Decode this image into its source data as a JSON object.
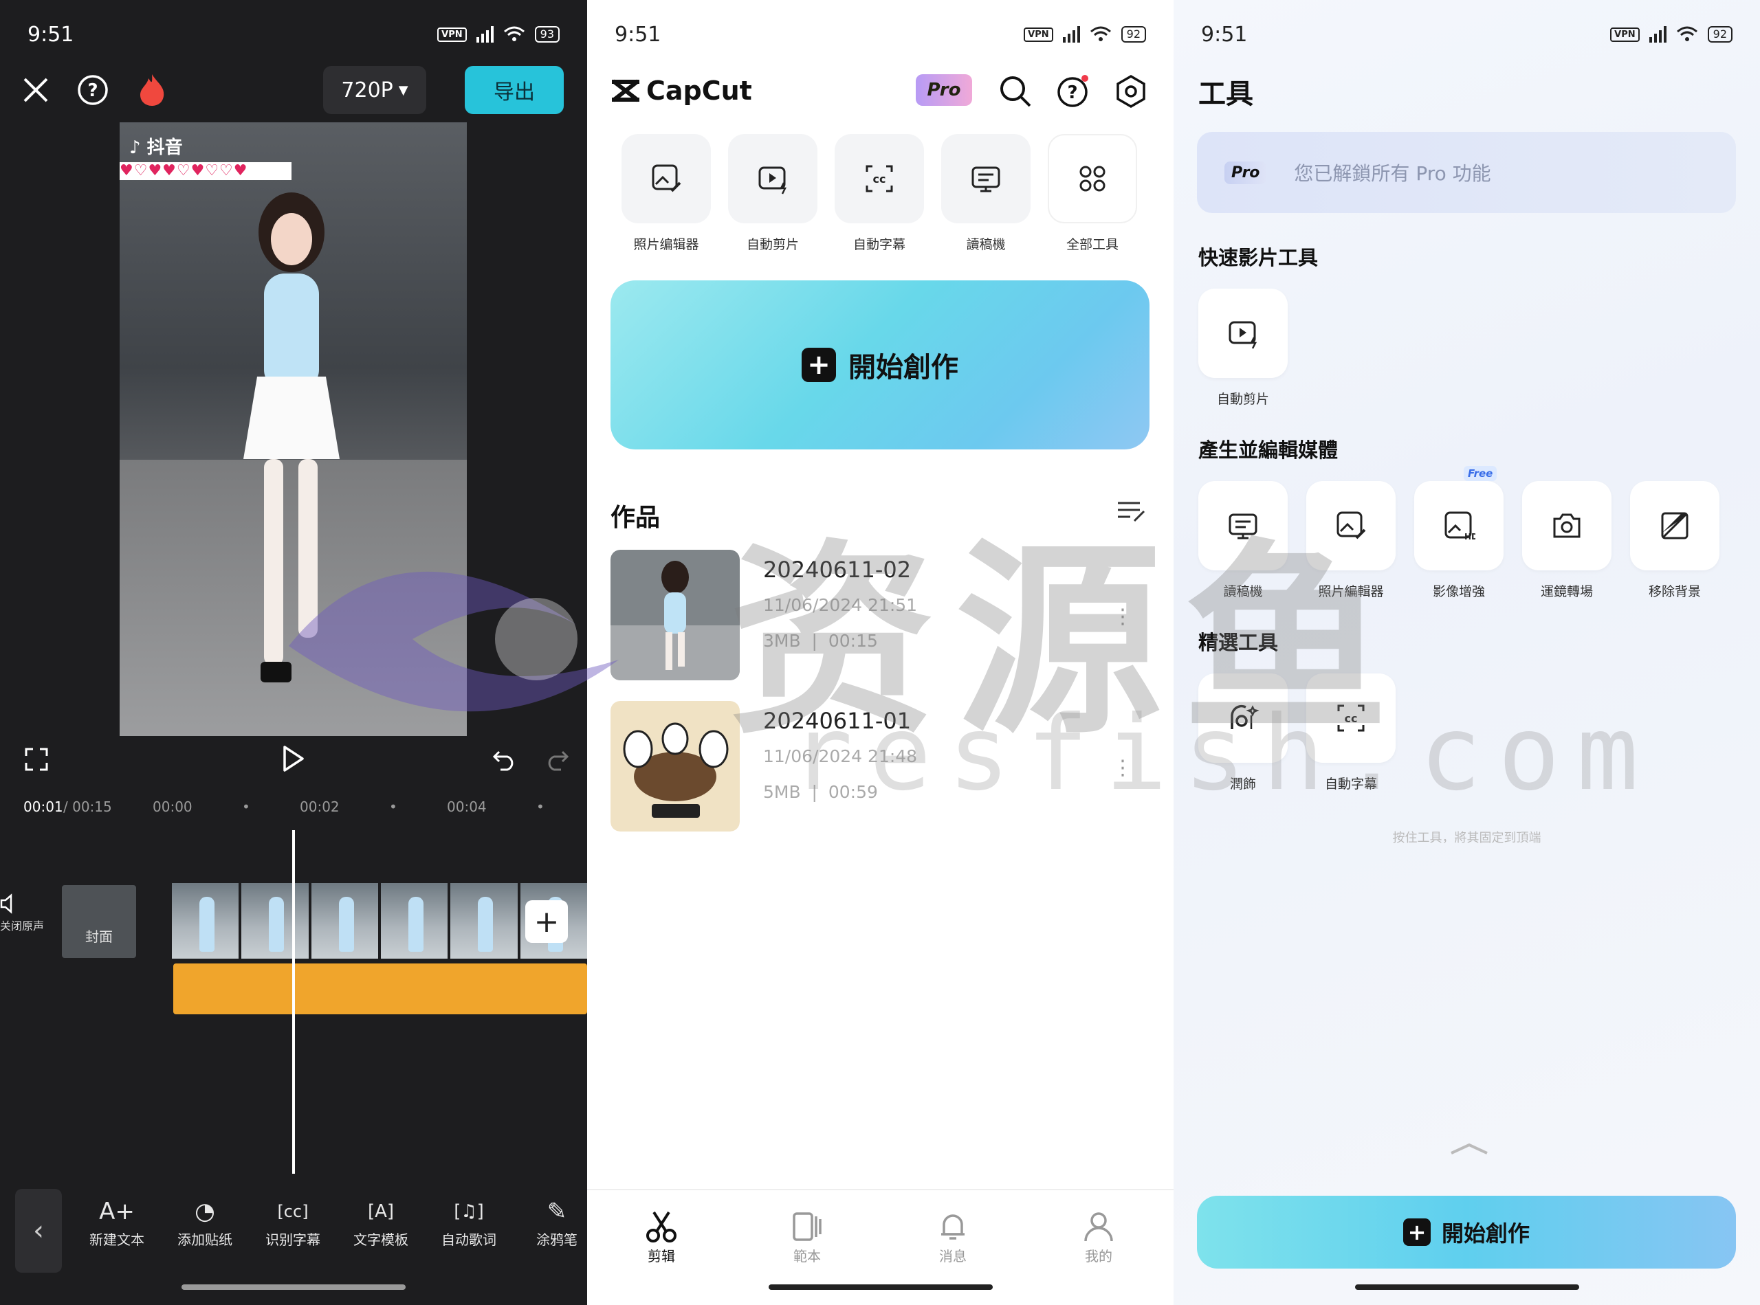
{
  "time": "9:51",
  "editor": {
    "battery": "93",
    "resolution": "720P",
    "export_label": "导出",
    "preview_app": "抖音",
    "preview_hearts": "♥♡♥♥♡♥♡♡♥",
    "time_current": "00:01",
    "time_total": "/ 00:15",
    "ruler": [
      "00:00",
      "00:02",
      "00:04"
    ],
    "mute_label": "关闭原声",
    "cover_label": "封面",
    "tools": [
      "新建文本",
      "添加贴纸",
      "识别字幕",
      "文字模板",
      "自动歌词",
      "涂鸦笔"
    ]
  },
  "home": {
    "battery": "92",
    "app_name": "CapCut",
    "pro_label": "Pro",
    "quick_tools": [
      "照片编辑器",
      "自動剪片",
      "自動字幕",
      "讀稿機",
      "全部工具"
    ],
    "create_label": "開始創作",
    "works_title": "作品",
    "projects": [
      {
        "name": "20240611-02",
        "date": "11/06/2024 21:51",
        "size": "3MB",
        "duration": "00:15"
      },
      {
        "name": "20240611-01",
        "date": "11/06/2024 21:48",
        "size": "5MB",
        "duration": "00:59"
      }
    ],
    "nav": [
      "剪辑",
      "範本",
      "消息",
      "我的"
    ]
  },
  "tools_page": {
    "battery": "92",
    "title": "工具",
    "pro_tag": "Pro",
    "pro_text": "您已解鎖所有 Pro 功能",
    "section1": "快速影片工具",
    "section1_items": [
      "自動剪片"
    ],
    "section2": "產生並編輯媒體",
    "section2_items": [
      "讀稿機",
      "照片編輯器",
      "影像增強",
      "運鏡轉場",
      "移除背景"
    ],
    "free_badge": "Free",
    "section3": "精選工具",
    "section3_items": [
      "潤飾",
      "自動字幕"
    ],
    "hint": "按住工具，將其固定到頂端",
    "create_label": "開始創作"
  },
  "watermark": {
    "cn": "资源鱼",
    "en": "resfish.com"
  }
}
